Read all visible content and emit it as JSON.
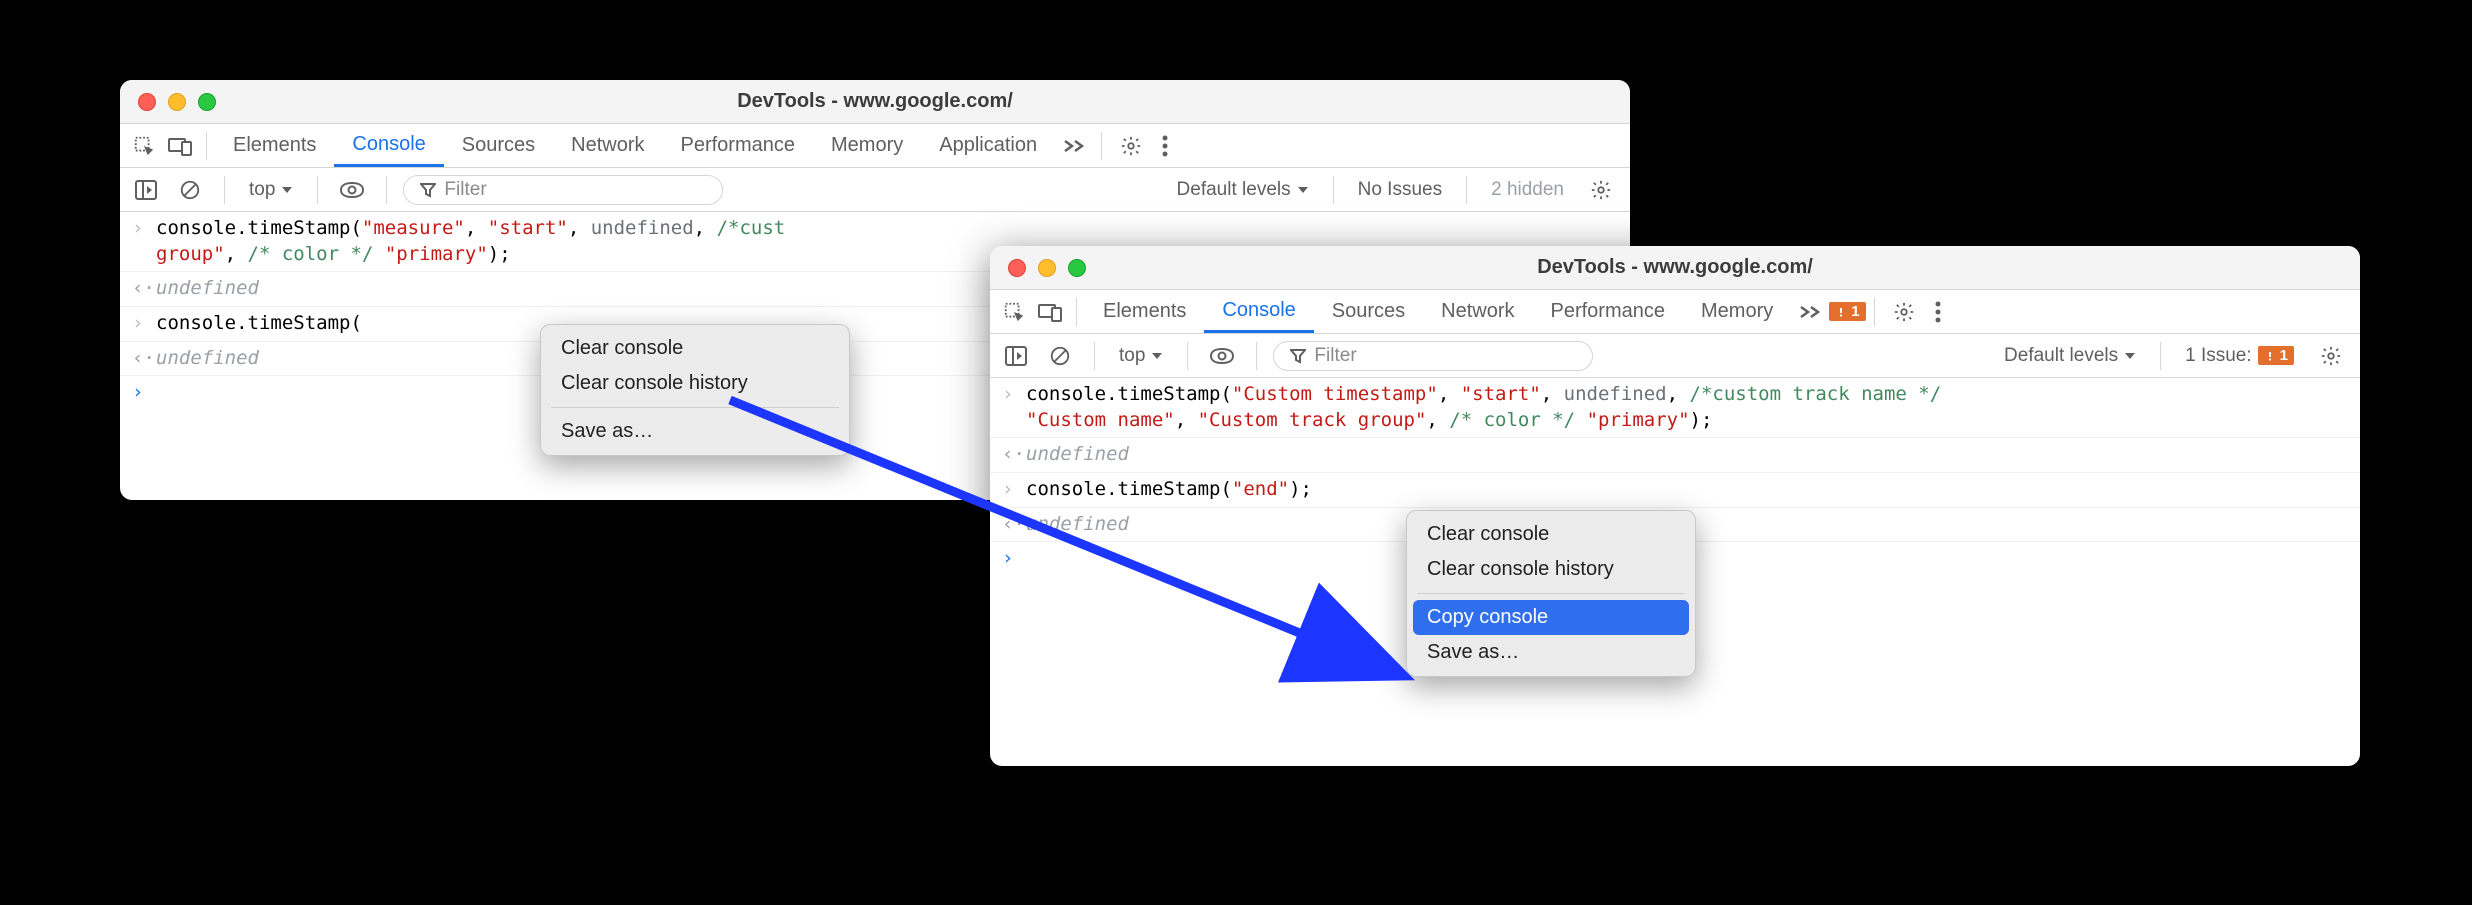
{
  "window1": {
    "title": "DevTools - www.google.com/",
    "tabs": [
      "Elements",
      "Console",
      "Sources",
      "Network",
      "Performance",
      "Memory",
      "Application"
    ],
    "active_tab": "Console",
    "context": "top",
    "filter_placeholder": "Filter",
    "levels": "Default levels",
    "no_issues": "No Issues",
    "hidden": "2 hidden",
    "menu": {
      "clear": "Clear console",
      "clear_history": "Clear console history",
      "save_as": "Save as…"
    },
    "rows": {
      "r0": {
        "pre": "console.timeStamp(",
        "s0": "\"measure\"",
        "c0": ", ",
        "s1": "\"start\"",
        "c1": ", ",
        "u0": "undefined",
        "c2": ", ",
        "cm0": "/*cust",
        "line2_pre": "group\"",
        "c3": ", ",
        "cm1": "/* color */",
        "c4": " ",
        "s2": "\"primary\"",
        "c5": ");"
      },
      "r1": "undefined",
      "r2": {
        "pre": "console.timeStamp("
      },
      "r3": "undefined"
    }
  },
  "window2": {
    "title": "DevTools - www.google.com/",
    "tabs": [
      "Elements",
      "Console",
      "Sources",
      "Network",
      "Performance",
      "Memory"
    ],
    "active_tab": "Console",
    "tab_issue_count": "1",
    "context": "top",
    "filter_placeholder": "Filter",
    "levels": "Default levels",
    "issues_label": "1 Issue:",
    "issues_count": "1",
    "menu": {
      "clear": "Clear console",
      "clear_history": "Clear console history",
      "copy": "Copy console",
      "save_as": "Save as…"
    },
    "rows": {
      "r0": {
        "pre": "console.timeStamp(",
        "s0": "\"Custom timestamp\"",
        "c0": ", ",
        "s1": "\"start\"",
        "c1": ", ",
        "u0": "undefined",
        "c2": ", ",
        "cm0": "/*custom track name */",
        "nl": "\n",
        "s2": "\"Custom name\"",
        "c3": ", ",
        "s3": "\"Custom track group\"",
        "c4": ", ",
        "cm1": "/* color */",
        "c5": " ",
        "s4": "\"primary\"",
        "c6": ");"
      },
      "r1": "undefined",
      "r2": {
        "pre": "console.timeStamp(",
        "s0": "\"end\"",
        "c0": ");"
      },
      "r3": "undefined"
    }
  }
}
